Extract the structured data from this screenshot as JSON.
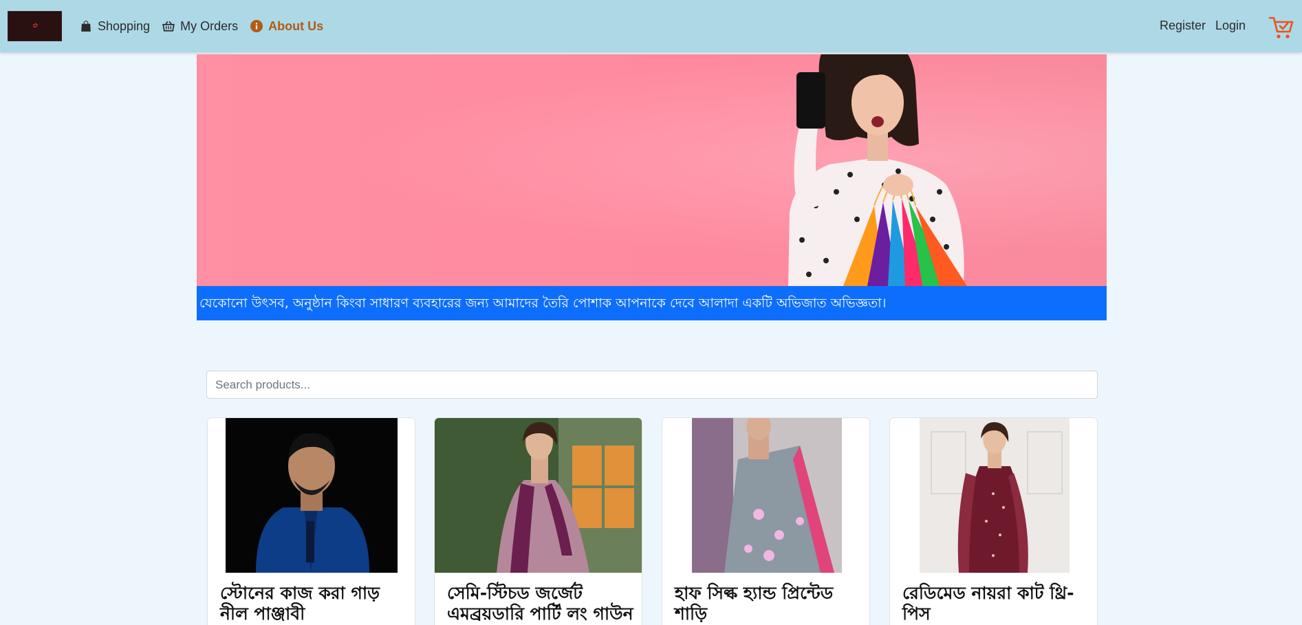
{
  "brand": {
    "logo_alt": "Shop logo"
  },
  "nav": {
    "left": [
      {
        "label": "Shopping",
        "icon": "shopping-bag-icon"
      },
      {
        "label": "My Orders",
        "icon": "basket-icon"
      },
      {
        "label": "About Us",
        "icon": "info-circle-icon",
        "active": true
      }
    ],
    "register_label": "Register",
    "login_label": "Login",
    "cart_icon": "cart-check-icon"
  },
  "hero": {
    "caption": "যেকোনো উৎসব, অনুষ্ঠান কিংবা সাধারণ ব্যবহারের জন্য আমাদের তৈরি পোশাক আপনাকে দেবে আলাদা একটি অভিজাত অভিজ্ঞতা।"
  },
  "search": {
    "placeholder": "Search products..."
  },
  "products": [
    {
      "title": "স্টোনের কাজ করা গাড় নীল পাঞ্জাবী"
    },
    {
      "title": "সেমি-স্টিচড জর্জেট এমব্রয়ডারি পার্টি লং গাউন"
    },
    {
      "title": "হাফ সিল্ক হ্যান্ড প্রিন্টেড শাড়ি"
    },
    {
      "title": "রেডিমেড নায়রা কাট থ্রি-পিস"
    }
  ],
  "colors": {
    "navbar_bg": "#add8e6",
    "page_bg": "#eef6fd",
    "active_link": "#b35b12",
    "caption_bg": "#0d6efd",
    "cart_icon": "#e8541a"
  }
}
